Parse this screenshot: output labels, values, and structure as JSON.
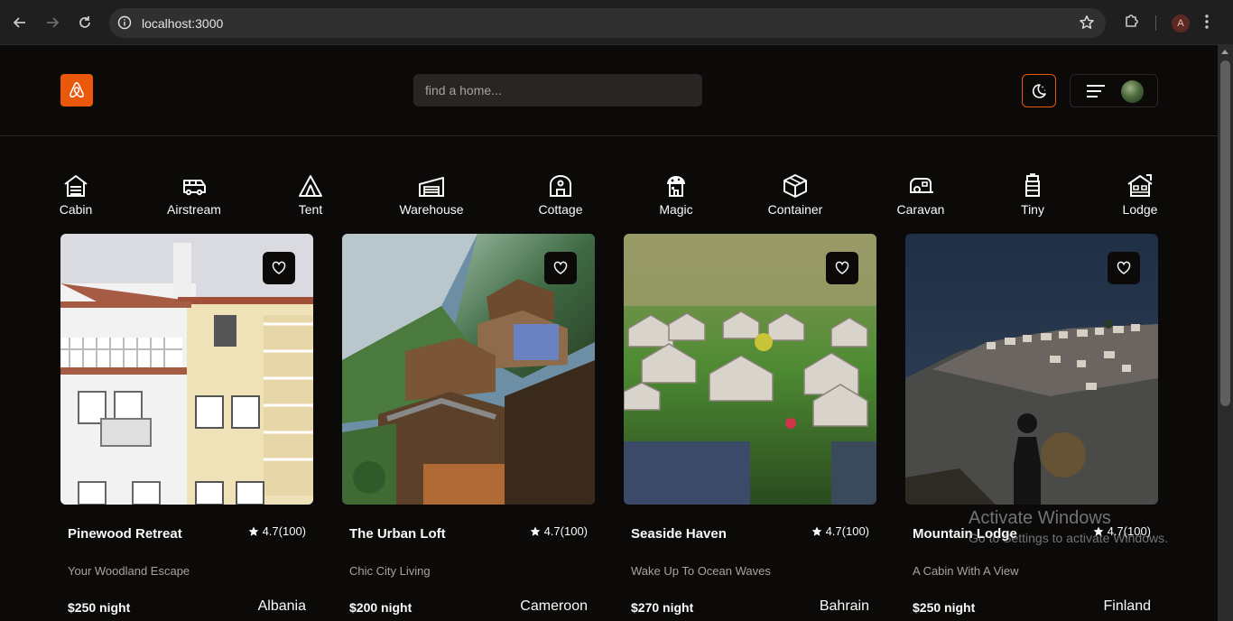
{
  "browser": {
    "url": "localhost:3000",
    "profile_initial": "A"
  },
  "header": {
    "search_placeholder": "find a home..."
  },
  "categories": [
    {
      "label": "Cabin",
      "icon": "cabin-icon"
    },
    {
      "label": "Airstream",
      "icon": "airstream-icon"
    },
    {
      "label": "Tent",
      "icon": "tent-icon"
    },
    {
      "label": "Warehouse",
      "icon": "warehouse-icon"
    },
    {
      "label": "Cottage",
      "icon": "cottage-icon"
    },
    {
      "label": "Magic",
      "icon": "magic-icon"
    },
    {
      "label": "Container",
      "icon": "container-icon"
    },
    {
      "label": "Caravan",
      "icon": "caravan-icon"
    },
    {
      "label": "Tiny",
      "icon": "tiny-icon"
    },
    {
      "label": "Lodge",
      "icon": "lodge-icon"
    }
  ],
  "properties": [
    {
      "name": "Pinewood Retreat",
      "rating": "4.7(100)",
      "tagline": "Your Woodland Escape",
      "price": "$250 night",
      "country": "Albania"
    },
    {
      "name": "The Urban Loft",
      "rating": "4.7(100)",
      "tagline": "Chic City Living",
      "price": "$200 night",
      "country": "Cameroon"
    },
    {
      "name": "Seaside Haven",
      "rating": "4.7(100)",
      "tagline": "Wake Up To Ocean Waves",
      "price": "$270 night",
      "country": "Bahrain"
    },
    {
      "name": "Mountain Lodge",
      "rating": "4.7(100)",
      "tagline": "A Cabin With A View",
      "price": "$250 night",
      "country": "Finland"
    }
  ],
  "watermark": {
    "title": "Activate Windows",
    "subtitle": "Go to Settings to activate Windows."
  },
  "colors": {
    "background": "#0c0a09",
    "accent": "#ea580c",
    "border": "#292524",
    "muted_text": "#a8a29e"
  }
}
